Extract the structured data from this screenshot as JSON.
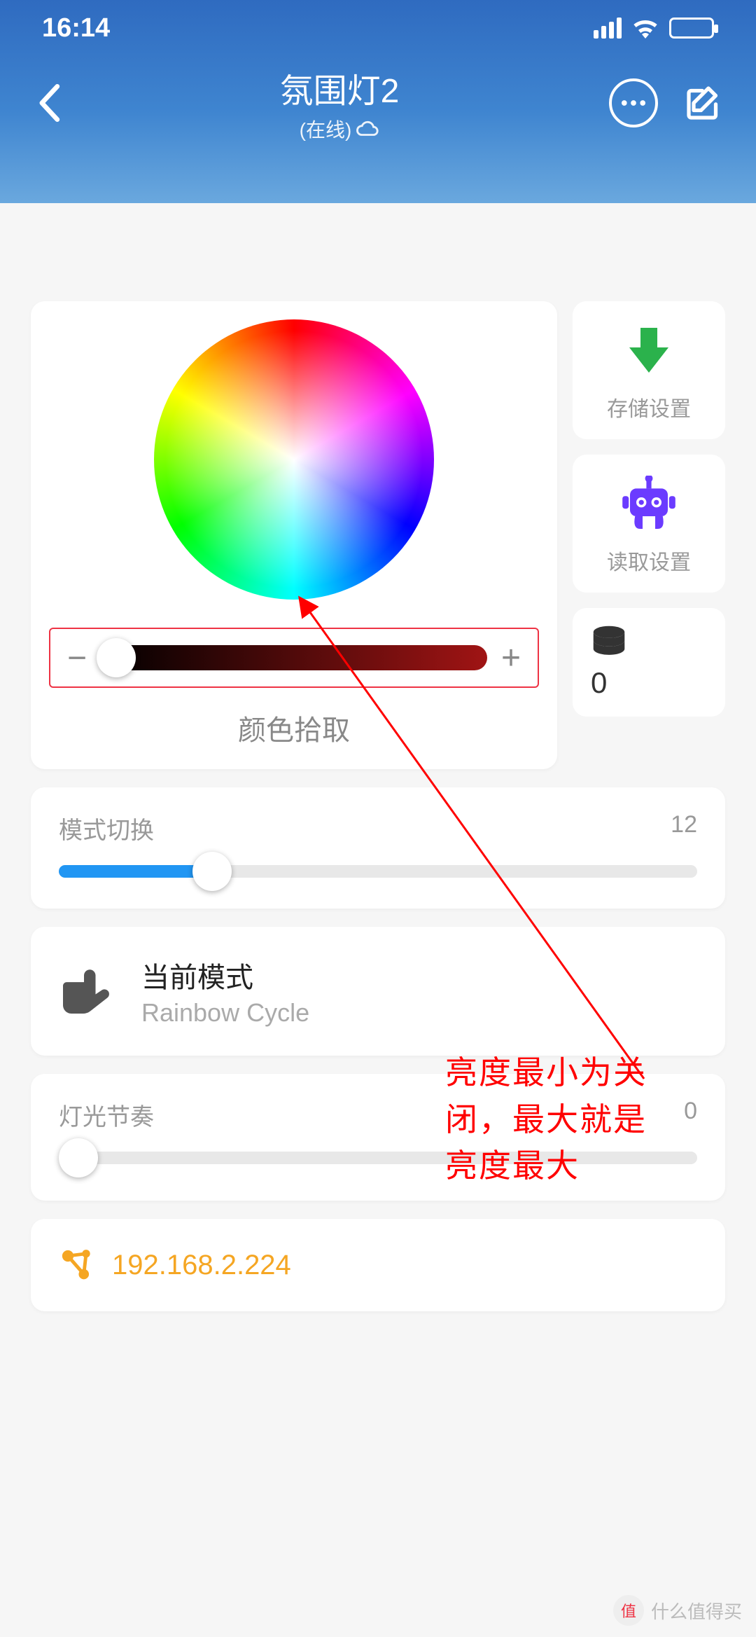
{
  "status": {
    "time": "16:14"
  },
  "header": {
    "title": "氛围灯2",
    "status_text": "(在线)"
  },
  "color_picker": {
    "minus": "−",
    "plus": "+",
    "label": "颜色拾取"
  },
  "side": {
    "save": "存储设置",
    "load": "读取设置",
    "count": "0"
  },
  "mode_switch": {
    "label": "模式切换",
    "value": "12"
  },
  "current_mode": {
    "title": "当前模式",
    "name": "Rainbow Cycle"
  },
  "rhythm": {
    "label": "灯光节奏",
    "value": "0"
  },
  "ip": {
    "address": "192.168.2.224"
  },
  "annotation": {
    "text": "亮度最小为关\n闭，最大就是\n亮度最大"
  },
  "watermark": {
    "text": "什么值得买"
  }
}
